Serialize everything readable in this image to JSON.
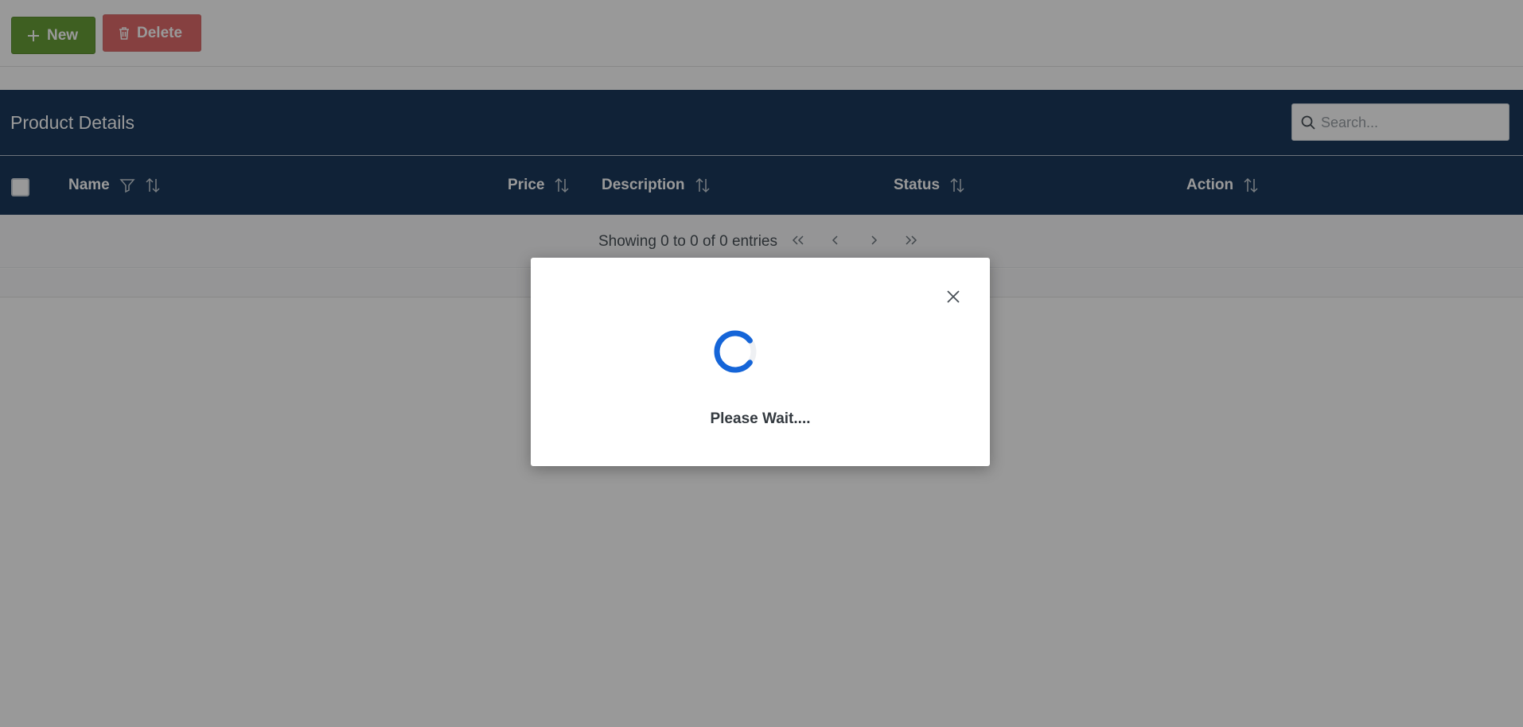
{
  "toolbar": {
    "new_label": "New",
    "delete_label": "Delete"
  },
  "table": {
    "title": "Product Details",
    "search_placeholder": "Search...",
    "columns": {
      "name": "Name",
      "price": "Price",
      "description": "Description",
      "status": "Status",
      "action": "Action"
    },
    "paginator_text": "Showing 0 to 0 of 0 entries"
  },
  "dialog": {
    "message": "Please Wait...."
  },
  "colors": {
    "header_bg": "#1b3a5c",
    "new_button": "#689f38",
    "delete_button": "#d32f2f",
    "spinner": "#1565d8"
  }
}
